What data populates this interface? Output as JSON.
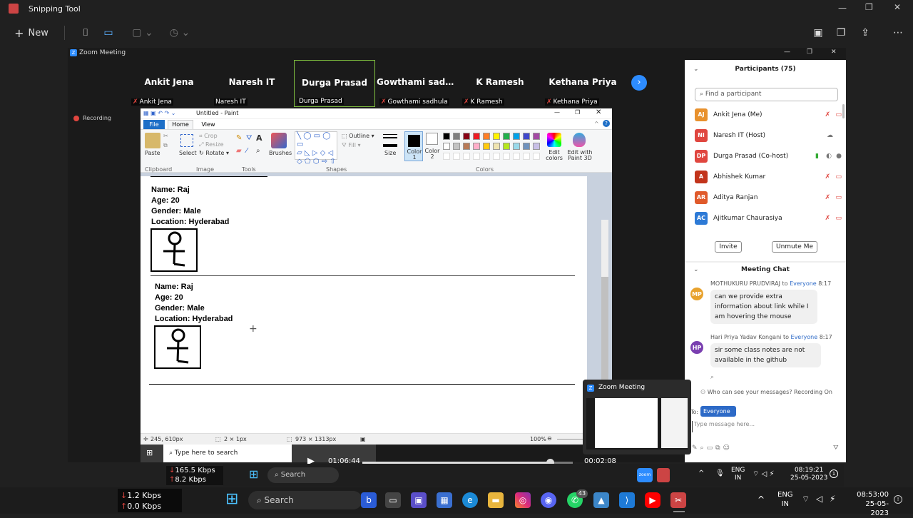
{
  "snip": {
    "title": "Snipping Tool",
    "new_label": "New"
  },
  "zoom": {
    "title": "Zoom Meeting",
    "recording": "Recording",
    "tiles": [
      {
        "name": "Ankit Jena",
        "sub": "Ankit Jena",
        "mic": true
      },
      {
        "name": "Naresh IT",
        "sub": "Naresh IT",
        "mic": false
      },
      {
        "name": "Durga Prasad",
        "sub": "Durga Prasad",
        "mic": false
      },
      {
        "name": "Gowthami sadh...",
        "sub": "Gowthami sadhula",
        "mic": true
      },
      {
        "name": "K Ramesh",
        "sub": "K Ramesh",
        "mic": true
      },
      {
        "name": "Kethana Priya",
        "sub": "Kethana Priya",
        "mic": true
      }
    ]
  },
  "paint": {
    "title": "Untitled - Paint",
    "menu": {
      "file": "File",
      "home": "Home",
      "view": "View"
    },
    "ribbon": {
      "paste": "Paste",
      "clipboard": "Clipboard",
      "crop": "Crop",
      "resize": "Resize",
      "rotate": "Rotate",
      "select": "Select",
      "image": "Image",
      "tools": "Tools",
      "brushes": "Brushes",
      "outline": "Outline",
      "fill": "Fill",
      "shapes": "Shapes",
      "size": "Size",
      "color1": "Color 1",
      "color2": "Color 2",
      "colors": "Colors",
      "edit_colors": "Edit colors",
      "edit_3d": "Edit with Paint 3D"
    },
    "cards": [
      {
        "name": "Name: Raj",
        "age": "Age: 20",
        "gender": "Gender: Male",
        "location": "Location: Hyderabad"
      },
      {
        "name": "Name: Raj",
        "age": "Age: 20",
        "gender": "Gender: Male",
        "location": "Location: Hyderabad"
      }
    ],
    "status": {
      "pos": "245, 610px",
      "sel": "2 × 1px",
      "size": "973 × 1313px",
      "zoom": "100%"
    },
    "palette": [
      "#000000",
      "#7f7f7f",
      "#880015",
      "#ed1c24",
      "#ff7f27",
      "#fff200",
      "#22b14c",
      "#00a2e8",
      "#3f48cc",
      "#a349a4",
      "#ffffff",
      "#c3c3c3",
      "#b97a57",
      "#ffaec9",
      "#ffc90e",
      "#efe4b0",
      "#b5e61d",
      "#99d9ea",
      "#7092be",
      "#c8bfe7"
    ]
  },
  "participants": {
    "title": "Participants (75)",
    "search_placeholder": "Find a participant",
    "list": [
      {
        "initials": "AJ",
        "name": "Ankit Jena (Me)",
        "color": "#e8912d"
      },
      {
        "initials": "NI",
        "name": "Naresh IT (Host)",
        "color": "#e0463f"
      },
      {
        "initials": "DP",
        "name": "Durga Prasad (Co-host)",
        "color": "#e0463f"
      },
      {
        "initials": "A",
        "name": "Abhishek Kumar",
        "color": "#c2341b"
      },
      {
        "initials": "AR",
        "name": "Aditya Ranjan",
        "color": "#e05a2b"
      },
      {
        "initials": "AC",
        "name": "Ajitkumar Chaurasiya",
        "color": "#2d7ad6"
      }
    ],
    "invite": "Invite",
    "unmute": "Unmute Me"
  },
  "chat": {
    "title": "Meeting Chat",
    "messages": [
      {
        "initials": "MP",
        "sender": "MOTHUKURU PRUDVIRAJ",
        "to": "to",
        "target": "Everyone",
        "time": "8:17",
        "text": "can we provide extra information about link while I am hovering the mouse",
        "color": "#e8a22d"
      },
      {
        "initials": "HP",
        "sender": "Hari Priya Yadav Kongani",
        "to": "to",
        "target": "Everyone",
        "time": "8:17",
        "text": "sir some class notes are not available in the github",
        "color": "#7a3fb0"
      }
    ],
    "privacy": "Who can see your messages? Recording On",
    "to_label": "To:",
    "to_value": "Everyone",
    "placeholder": "Type message here..."
  },
  "thumb": {
    "title": "Zoom Meeting"
  },
  "player": {
    "elapsed": "01:06:44",
    "remaining": "00:02:08",
    "progress": 0.89
  },
  "inner_taskbar": {
    "search": "Type here to search",
    "search2": "Search",
    "net_down": "165.5 Kbps",
    "net_up": "8.2 Kbps",
    "lang": "ENG",
    "region": "IN",
    "time": "08:19:21",
    "date": "25-05-2023",
    "badge": "1"
  },
  "taskbar": {
    "net_down": "1.2 Kbps",
    "net_up": "0.0 Kbps",
    "search": "Search",
    "lang": "ENG",
    "region": "IN",
    "time": "08:53:00",
    "date": "25-05-2023",
    "whatsapp_badge": "43"
  }
}
